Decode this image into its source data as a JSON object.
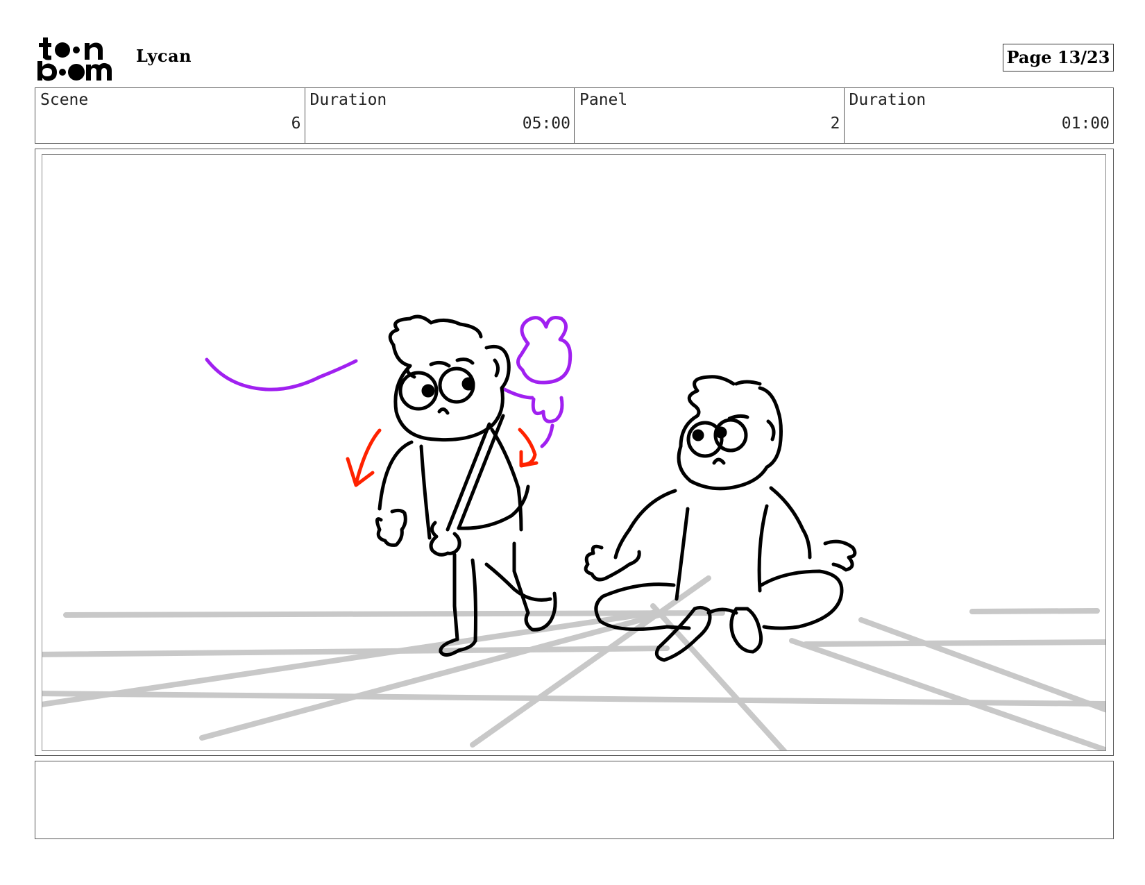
{
  "header": {
    "logo_name": "toon boom",
    "project_title": "Lycan",
    "page": "Page 13/23"
  },
  "info": {
    "scene_label": "Scene",
    "scene_value": "6",
    "scene_duration_label": "Duration",
    "scene_duration_value": "05:00",
    "panel_label": "Panel",
    "panel_value": "2",
    "panel_duration_label": "Duration",
    "panel_duration_value": "01:00"
  },
  "colors": {
    "line": "#000000",
    "floor": "#c8c8c8",
    "purple": "#a020f0",
    "red": "#ff2200"
  },
  "notes": ""
}
